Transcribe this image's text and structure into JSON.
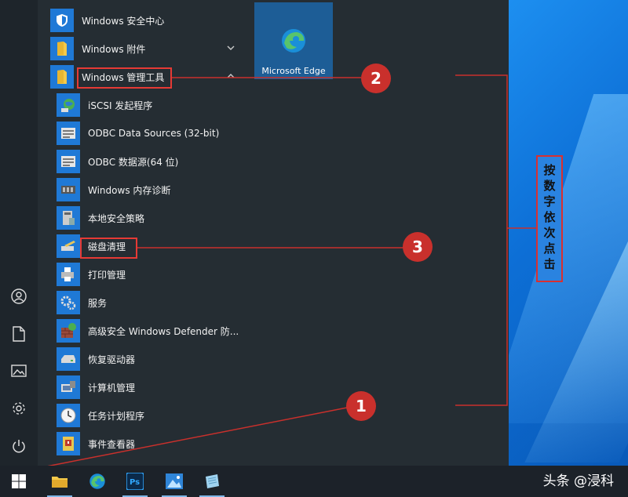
{
  "start_menu": {
    "apps": [
      {
        "label": "Windows 安全中心",
        "icon": "shield-icon",
        "kind": "top"
      },
      {
        "label": "Windows 附件",
        "icon": "folder-icon",
        "kind": "folder",
        "expand": "chevron-down-icon"
      },
      {
        "label": "Windows 管理工具",
        "icon": "folder-icon",
        "kind": "folder",
        "expand": "chevron-up-icon"
      },
      {
        "label": "iSCSI 发起程序",
        "icon": "globe-network-icon",
        "kind": "sub"
      },
      {
        "label": "ODBC Data Sources (32-bit)",
        "icon": "odbc-icon",
        "kind": "sub"
      },
      {
        "label": "ODBC 数据源(64 位)",
        "icon": "odbc-icon",
        "kind": "sub"
      },
      {
        "label": "Windows 内存诊断",
        "icon": "memory-chip-icon",
        "kind": "sub"
      },
      {
        "label": "本地安全策略",
        "icon": "security-policy-icon",
        "kind": "sub"
      },
      {
        "label": "磁盘清理",
        "icon": "disk-cleanup-icon",
        "kind": "sub"
      },
      {
        "label": "打印管理",
        "icon": "printer-icon",
        "kind": "sub"
      },
      {
        "label": "服务",
        "icon": "gears-icon",
        "kind": "sub"
      },
      {
        "label": "高级安全 Windows Defender 防...",
        "icon": "firewall-icon",
        "kind": "sub"
      },
      {
        "label": "恢复驱动器",
        "icon": "drive-icon",
        "kind": "sub"
      },
      {
        "label": "计算机管理",
        "icon": "computer-management-icon",
        "kind": "sub"
      },
      {
        "label": "任务计划程序",
        "icon": "clock-icon",
        "kind": "sub"
      },
      {
        "label": "事件查看器",
        "icon": "event-viewer-icon",
        "kind": "sub"
      }
    ],
    "tile": {
      "label": "Microsoft Edge",
      "icon": "edge-icon"
    },
    "rail": [
      "user-icon",
      "document-icon",
      "pictures-icon",
      "settings-gear-icon",
      "power-icon"
    ]
  },
  "taskbar": {
    "items": [
      "windows-start-icon",
      "file-explorer-icon",
      "edge-icon",
      "photoshop-icon",
      "photos-icon",
      "notes-icon"
    ],
    "watermark": "头条 @浸科"
  },
  "annotations": {
    "step1": "1",
    "step2": "2",
    "step3": "3",
    "instruction": "按数字依次点击"
  },
  "colors": {
    "highlight": "#e63a35",
    "callout": "#c9302c",
    "menu_bg": "#252d33",
    "tile_bg": "#1d5d96"
  }
}
